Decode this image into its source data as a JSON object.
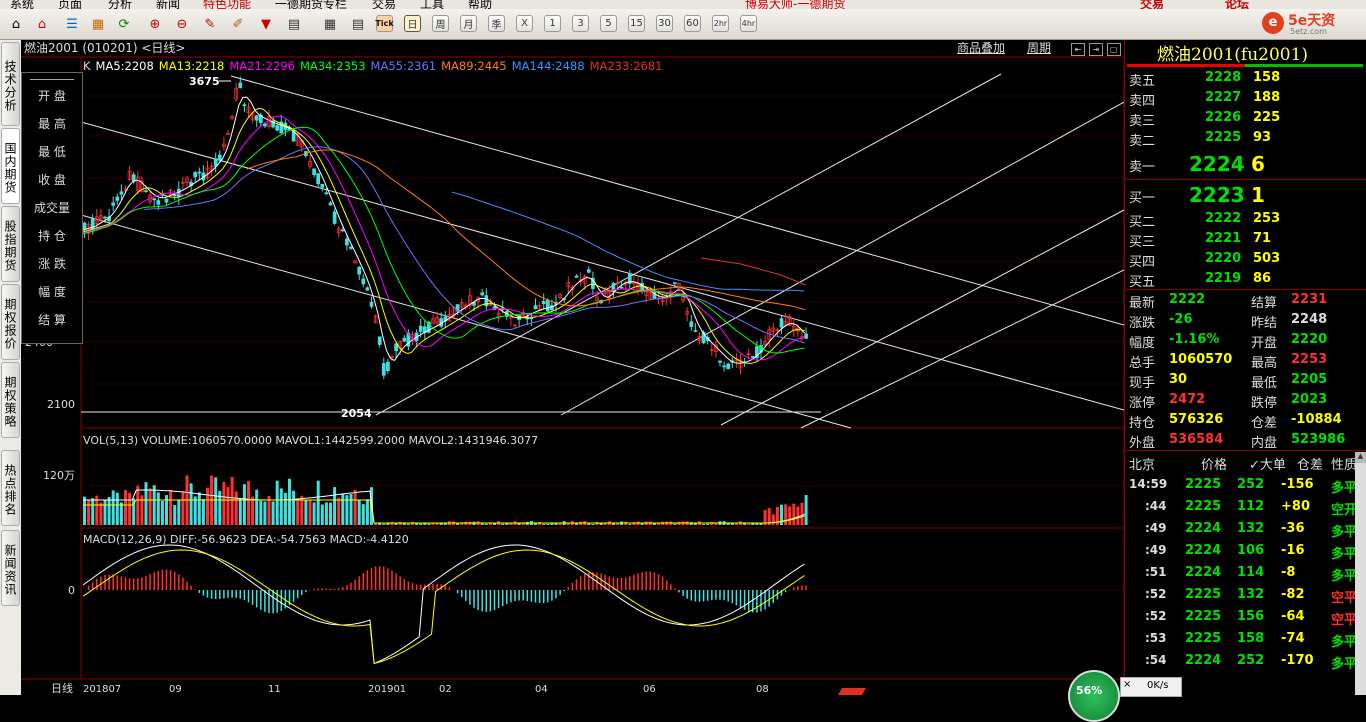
{
  "menubar": [
    "系统",
    "页面",
    "分析",
    "新闻",
    "特色功能",
    "一德期货专栏",
    "交易",
    "工具",
    "帮助",
    "博易大师-一德期货"
  ],
  "menubar_right": {
    "trade": "交易",
    "forum": "论坛",
    "logo": "5e天资",
    "logo_sub": "5etz.com"
  },
  "toolbar": {
    "periods": [
      "日",
      "周",
      "月",
      "季",
      "X",
      "1",
      "3",
      "5",
      "15",
      "30",
      "60",
      "2hr",
      "4hr"
    ],
    "tick": "Tick"
  },
  "leftnav": [
    "技术分析",
    "国内期货",
    "股指期货",
    "期权报价",
    "期权策略",
    "热点排名",
    "新闻资讯"
  ],
  "chart_header": {
    "title": "燃油2001 (010201) <日线>",
    "overlay_link": "商品叠加",
    "period_link": "周期"
  },
  "ma_line": [
    {
      "text": "K",
      "color": "#dddddd"
    },
    {
      "text": "MA5:2208",
      "color": "#ffffff"
    },
    {
      "text": "MA13:2218",
      "color": "#ffff00"
    },
    {
      "text": "MA21:2296",
      "color": "#ff00ff"
    },
    {
      "text": "MA34:2353",
      "color": "#00ff00"
    },
    {
      "text": "MA55:2361",
      "color": "#7070ff"
    },
    {
      "text": "MA89:2445",
      "color": "#ff8000"
    },
    {
      "text": "MA144:2488",
      "color": "#4090ff"
    },
    {
      "text": "MA233:2681",
      "color": "#e03030"
    }
  ],
  "infobox": [
    "开  盘",
    "最  高",
    "最  低",
    "收  盘",
    "成交量",
    "持  仓",
    "涨  跌",
    "幅  度",
    "结  算"
  ],
  "price_axis": [
    {
      "label": "2400",
      "value": 2400
    },
    {
      "label": "2100",
      "value": 2100
    }
  ],
  "price_annotations": {
    "high": "3675",
    "low": "2054"
  },
  "volume": {
    "header": "VOL(5,13)  VOLUME:1060570.0000  MAVOL1:1442599.2000  MAVOL2:1431946.3077",
    "axis_label": "120万"
  },
  "macd": {
    "header": "MACD(12,26,9)  DIFF:-56.9623  DEA:-54.7563  MACD:-4.4120",
    "axis_label": "0"
  },
  "date_axis": {
    "corner": "日线",
    "labels": [
      "201807",
      "09",
      "11",
      "201901",
      "02",
      "04",
      "06",
      "08"
    ]
  },
  "quote": {
    "title": "燃油2001(fu2001)",
    "asks": [
      {
        "label": "卖五",
        "price": "2228",
        "vol": "158"
      },
      {
        "label": "卖四",
        "price": "2227",
        "vol": "188"
      },
      {
        "label": "卖三",
        "price": "2226",
        "vol": "225"
      },
      {
        "label": "卖二",
        "price": "2225",
        "vol": "93"
      },
      {
        "label": "卖一",
        "price": "2224",
        "vol": "6"
      }
    ],
    "bids": [
      {
        "label": "买一",
        "price": "2223",
        "vol": "1"
      },
      {
        "label": "买二",
        "price": "2222",
        "vol": "253"
      },
      {
        "label": "买三",
        "price": "2221",
        "vol": "71"
      },
      {
        "label": "买四",
        "price": "2220",
        "vol": "503"
      },
      {
        "label": "买五",
        "price": "2219",
        "vol": "86"
      }
    ],
    "stats": [
      {
        "l1": "最新",
        "v1": "2222",
        "c1": "g",
        "l2": "结算",
        "v2": "2231",
        "c2": "r"
      },
      {
        "l1": "涨跌",
        "v1": "-26",
        "c1": "g",
        "l2": "昨结",
        "v2": "2248",
        "c2": "w"
      },
      {
        "l1": "幅度",
        "v1": "-1.16%",
        "c1": "g",
        "l2": "开盘",
        "v2": "2220",
        "c2": "g"
      },
      {
        "l1": "总手",
        "v1": "1060570",
        "c1": "y",
        "l2": "最高",
        "v2": "2253",
        "c2": "r"
      },
      {
        "l1": "现手",
        "v1": "30",
        "c1": "y",
        "l2": "最低",
        "v2": "2205",
        "c2": "g"
      },
      {
        "l1": "涨停",
        "v1": "2472",
        "c1": "r",
        "l2": "跌停",
        "v2": "2023",
        "c2": "g"
      },
      {
        "l1": "持仓",
        "v1": "576326",
        "c1": "y",
        "l2": "仓差",
        "v2": "-10884",
        "c2": "y"
      },
      {
        "l1": "外盘",
        "v1": "536584",
        "c1": "r",
        "l2": "内盘",
        "v2": "523986",
        "c2": "g"
      }
    ],
    "trade_header": [
      "北京",
      "价格",
      "✓大单",
      "仓差",
      "性质"
    ],
    "trades": [
      {
        "time": "14:59",
        "price": "2225",
        "vol": "252",
        "diff": "-156",
        "nature": "多平",
        "nc": "g"
      },
      {
        "time": ":44",
        "price": "2225",
        "vol": "112",
        "diff": "+80",
        "nature": "空开",
        "nc": "g"
      },
      {
        "time": ":49",
        "price": "2224",
        "vol": "132",
        "diff": "-36",
        "nature": "多平",
        "nc": "g"
      },
      {
        "time": ":49",
        "price": "2224",
        "vol": "106",
        "diff": "-16",
        "nature": "多平",
        "nc": "g"
      },
      {
        "time": ":51",
        "price": "2224",
        "vol": "114",
        "diff": "-8",
        "nature": "多平",
        "nc": "g"
      },
      {
        "time": ":52",
        "price": "2225",
        "vol": "132",
        "diff": "-82",
        "nature": "空平",
        "nc": "r"
      },
      {
        "time": ":52",
        "price": "2225",
        "vol": "156",
        "diff": "-64",
        "nature": "空平",
        "nc": "r"
      },
      {
        "time": ":53",
        "price": "2225",
        "vol": "158",
        "diff": "-74",
        "nature": "多平",
        "nc": "g"
      },
      {
        "time": ":54",
        "price": "2224",
        "vol": "252",
        "diff": "-170",
        "nature": "多平",
        "nc": "g"
      }
    ]
  },
  "statusbar": {
    "gauge": "56%",
    "speed": "0K/s"
  },
  "colors": {
    "up": "#ff3030",
    "down": "#40e0e0",
    "grid": "#8b0000",
    "ask_price": "#00e000",
    "ask_vol": "#ffff00"
  }
}
